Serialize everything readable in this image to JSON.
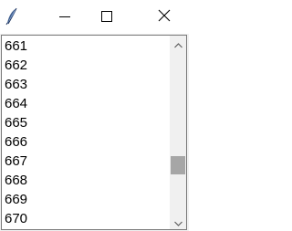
{
  "window": {
    "icon": "feather-icon",
    "controls": {
      "minimize_icon": "minimize-icon",
      "maximize_icon": "maximize-icon",
      "close_icon": "close-icon"
    }
  },
  "listbox": {
    "items": [
      "661",
      "662",
      "663",
      "664",
      "665",
      "666",
      "667",
      "668",
      "669",
      "670"
    ]
  },
  "scrollbar": {
    "position": 0.73,
    "visible_fraction": 0.11
  },
  "colors": {
    "titlebar": "#ffffff",
    "window_bg": "#f0f0f0",
    "thumb": "#a6a6a6",
    "border": "#7a7a7a"
  }
}
